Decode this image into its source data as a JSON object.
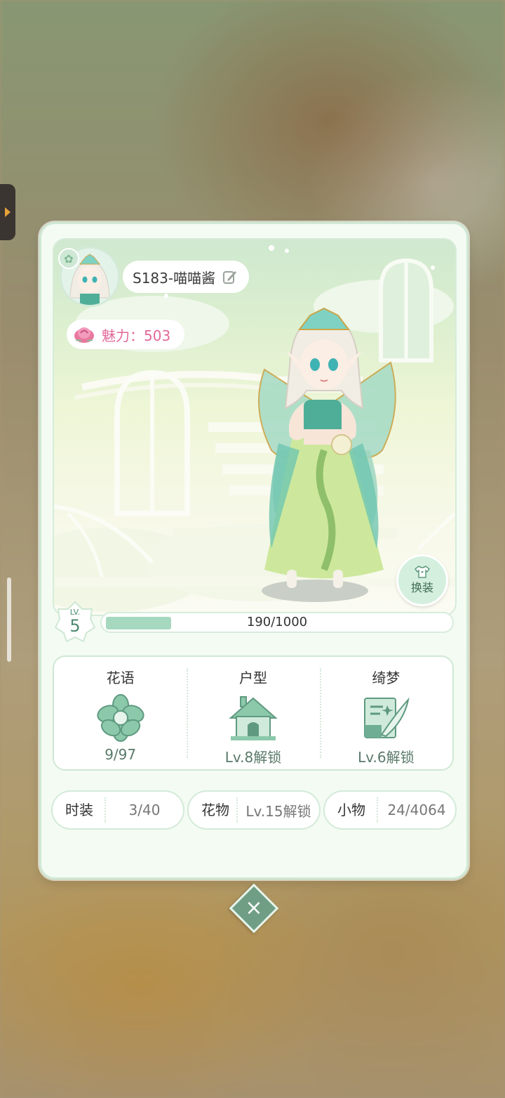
{
  "profile": {
    "name": "S183-喵喵酱",
    "charm_label": "魅力：503",
    "outfit_button": "换装"
  },
  "level": {
    "label": "LV.",
    "value": "5",
    "xp_text": "190/1000",
    "progress": 0.19
  },
  "stats": [
    {
      "title": "花语",
      "icon": "flower-icon",
      "value": "9/97"
    },
    {
      "title": "户型",
      "icon": "house-icon",
      "value": "Lv.8解锁"
    },
    {
      "title": "绮梦",
      "icon": "dream-quill-icon",
      "value": "Lv.6解锁"
    }
  ],
  "chips": [
    {
      "key": "时装",
      "value": "3/40"
    },
    {
      "key": "花物",
      "value": "Lv.15解锁"
    },
    {
      "key": "小物",
      "value": "24/4064"
    }
  ],
  "colors": {
    "accent": "#6f9e84",
    "charm": "#e26a9a",
    "panel": "#f4fbf3"
  }
}
